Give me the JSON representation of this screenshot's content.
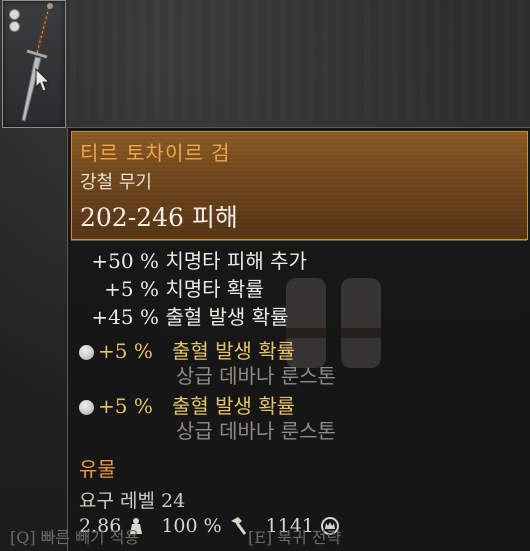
{
  "item": {
    "name": "티르 토차이르 검",
    "type": "강철 무기",
    "damage": "202-246 피해",
    "stats": [
      {
        "value": "+50 %",
        "label": "치명타 피해 추가"
      },
      {
        "value": "+5 %",
        "label": "치명타 확률"
      },
      {
        "value": "+45 %",
        "label": "출혈 발생 확률"
      }
    ],
    "runes": [
      {
        "value": "+5 %",
        "label": "출혈 발생 확률",
        "source": "상급 데바나 룬스톤"
      },
      {
        "value": "+5 %",
        "label": "출혈 발생 확률",
        "source": "상급 데바나 룬스톤"
      }
    ],
    "rarity": "유물",
    "required_level": "요구 레벨 24",
    "weight": "2.86",
    "durability": "100 %",
    "price": "1141"
  },
  "hints": {
    "left": "[Q] 빠른 빼기 적용",
    "right": "[E] 북귀 전략"
  },
  "icons": {
    "weight": "weight-icon",
    "durability": "hammer-icon",
    "price": "crown-coin-icon"
  },
  "colors": {
    "accent": "#f0a94a",
    "rune": "#e6c36a",
    "rarity": "#e89a3c"
  }
}
